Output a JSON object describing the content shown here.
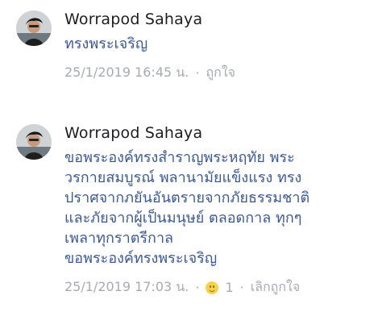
{
  "comments": [
    {
      "author": "Worrapod Sahaya",
      "text": "ทรงพระเจริญ",
      "timestamp": "25/1/2019 16:45 น.",
      "separator": "·",
      "action": "ถูกใจ"
    },
    {
      "author": "Worrapod Sahaya",
      "text": "ขอพระองค์ทรงสำราญพระหฤทัย  พระ\nวรกายสมบูรณ์ พลานามัยแข็งแรง ทรง\nปราศจากภยันอันตรายจากภัยธรรมชาติ\nและภัยจากผู้เป็นมนุษย์ ตลอดกาล ทุกๆ\nเพลาทุกราตรีกาล\nขอพระองค์ทรงพระเจริญ",
      "timestamp": "25/1/2019 17:03 น.",
      "separator": "·",
      "reaction_icon": "smiley-reaction-icon",
      "reaction_count": "1",
      "action": "เลิกถูกใจ"
    }
  ]
}
